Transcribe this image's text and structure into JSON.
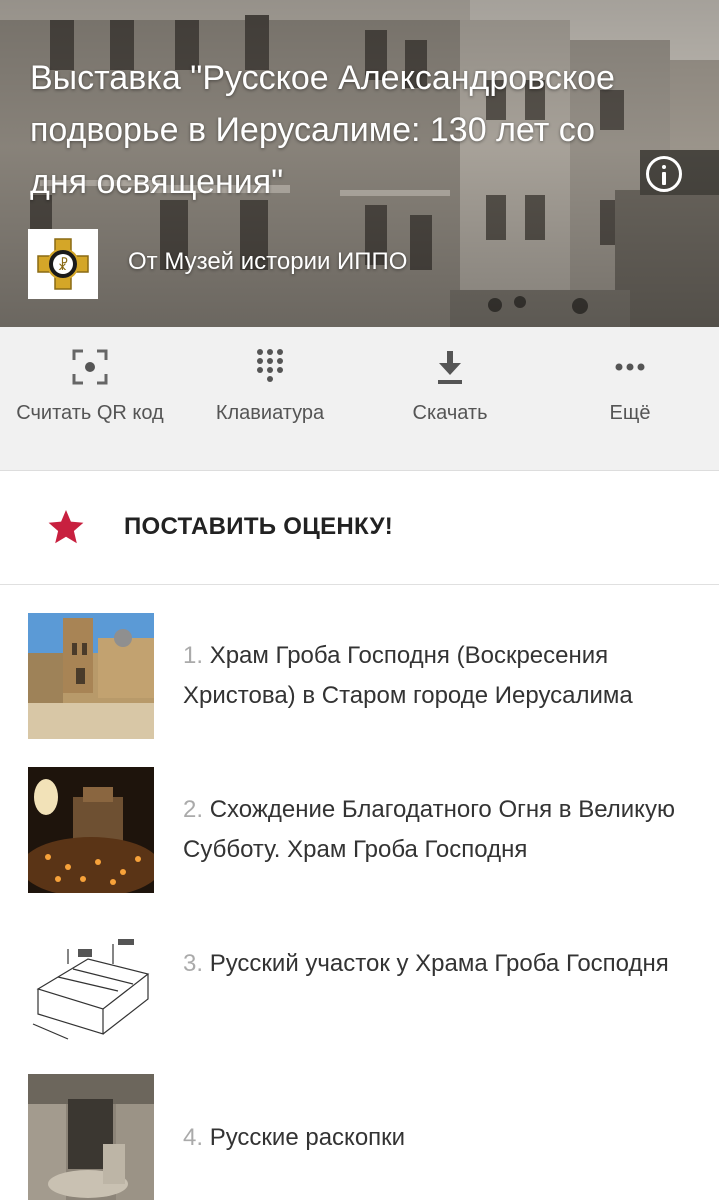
{
  "header": {
    "title": "Выставка \"Русское Александровское подворье в Иерусалиме: 130 лет со дня освящения\"",
    "author": "От Музей истории ИППО",
    "info_icon": "info-circle-icon",
    "logo_icon": "ippo-emblem-icon"
  },
  "toolbar": {
    "items": [
      {
        "label": "Считать QR код",
        "icon": "qr-scan-icon"
      },
      {
        "label": "Клавиатура",
        "icon": "keypad-icon"
      },
      {
        "label": "Скачать",
        "icon": "download-icon"
      },
      {
        "label": "Ещё",
        "icon": "more-dots-icon"
      }
    ]
  },
  "rating": {
    "label": "ПОСТАВИТЬ ОЦЕНКУ!",
    "icon": "star-icon",
    "color": "#c8203f"
  },
  "exhibits": [
    {
      "number": "1.",
      "title": "Храм Гроба Господня (Воскресения Христова) в Старом городе Иерусалима"
    },
    {
      "number": "2.",
      "title": "Схождение Благодатного Огня в Великую Субботу. Храм Гроба Господня"
    },
    {
      "number": "3.",
      "title": "Русский участок у Храма Гроба Господня"
    },
    {
      "number": "4.",
      "title": "Русские раскопки"
    }
  ]
}
